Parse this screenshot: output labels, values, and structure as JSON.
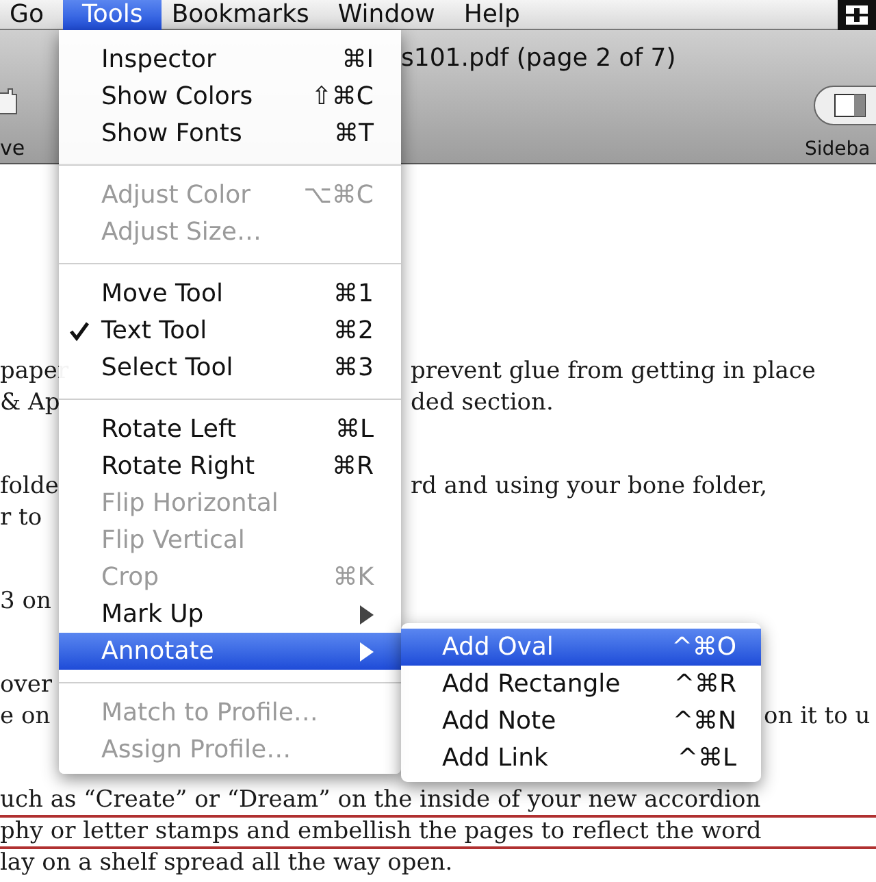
{
  "menu_bar": [
    {
      "label": "Go",
      "selected": false
    },
    {
      "label": "Tools",
      "selected": true
    },
    {
      "label": "Bookmarks",
      "selected": false
    },
    {
      "label": "Window",
      "selected": false
    },
    {
      "label": "Help",
      "selected": false
    }
  ],
  "window": {
    "title": "s101.pdf (page 2 of 7)"
  },
  "toolbar": {
    "left_label": "ve",
    "right_label": "Sideba"
  },
  "tools_menu": [
    {
      "kind": "item",
      "label": "Inspector",
      "shortcut": "⌘I",
      "disabled": false,
      "checked": false,
      "selected": false
    },
    {
      "kind": "item",
      "label": "Show Colors",
      "shortcut": "⇧⌘C",
      "disabled": false,
      "checked": false,
      "selected": false
    },
    {
      "kind": "item",
      "label": "Show Fonts",
      "shortcut": "⌘T",
      "disabled": false,
      "checked": false,
      "selected": false
    },
    {
      "kind": "separator"
    },
    {
      "kind": "item",
      "label": "Adjust Color",
      "shortcut": "⌥⌘C",
      "disabled": true,
      "checked": false,
      "selected": false
    },
    {
      "kind": "item",
      "label": "Adjust Size…",
      "disabled": true,
      "checked": false,
      "selected": false
    },
    {
      "kind": "separator"
    },
    {
      "kind": "item",
      "label": "Move Tool",
      "shortcut": "⌘1",
      "disabled": false,
      "checked": false,
      "selected": false
    },
    {
      "kind": "item",
      "label": "Text Tool",
      "shortcut": "⌘2",
      "disabled": false,
      "checked": true,
      "selected": false
    },
    {
      "kind": "item",
      "label": "Select Tool",
      "shortcut": "⌘3",
      "disabled": false,
      "checked": false,
      "selected": false
    },
    {
      "kind": "separator"
    },
    {
      "kind": "item",
      "label": "Rotate Left",
      "shortcut": "⌘L",
      "disabled": false,
      "checked": false,
      "selected": false
    },
    {
      "kind": "item",
      "label": "Rotate Right",
      "shortcut": "⌘R",
      "disabled": false,
      "checked": false,
      "selected": false
    },
    {
      "kind": "item",
      "label": "Flip Horizontal",
      "disabled": true,
      "checked": false,
      "selected": false
    },
    {
      "kind": "item",
      "label": "Flip Vertical",
      "disabled": true,
      "checked": false,
      "selected": false
    },
    {
      "kind": "item",
      "label": "Crop",
      "shortcut": "⌘K",
      "disabled": true,
      "checked": false,
      "selected": false
    },
    {
      "kind": "submenu",
      "label": "Mark Up",
      "disabled": false,
      "checked": false,
      "selected": false
    },
    {
      "kind": "submenu",
      "label": "Annotate",
      "disabled": false,
      "checked": false,
      "selected": true
    },
    {
      "kind": "separator"
    },
    {
      "kind": "item",
      "label": "Match to Profile…",
      "disabled": true,
      "checked": false,
      "selected": false
    },
    {
      "kind": "item",
      "label": "Assign Profile…",
      "disabled": true,
      "checked": false,
      "selected": false
    }
  ],
  "annotate_submenu": [
    {
      "label": "Add Oval",
      "shortcut": "^⌘O",
      "selected": true
    },
    {
      "label": "Add Rectangle",
      "shortcut": "^⌘R",
      "selected": false
    },
    {
      "label": "Add Note",
      "shortcut": "^⌘N",
      "selected": false
    },
    {
      "label": "Add Link",
      "shortcut": "^⌘L",
      "selected": false
    }
  ],
  "document": {
    "paragraphs": [
      [
        {
          "left": "paper",
          "right": "prevent glue from getting in place",
          "underlined": false
        },
        {
          "left": "& Ap",
          "right": "ded section.",
          "underlined": false
        }
      ],
      [
        {
          "left": "folde",
          "right": "rd and using your bone folder,",
          "underlined": false
        },
        {
          "left": "r to",
          "underlined": false
        }
      ],
      [
        {
          "left": "3 on",
          "underlined": false
        }
      ],
      [
        {
          "left": "over",
          "underlined": false
        },
        {
          "left": "e on",
          "far_right": "on it to u",
          "underlined": false
        }
      ],
      [
        {
          "left": "uch as “Create” or “Dream” on the inside of your new accordion",
          "underlined": true
        },
        {
          "left": "phy or letter stamps and embellish the pages to reflect the word",
          "underlined": true
        },
        {
          "left": "lay on a shelf spread all the way open.",
          "underlined": false
        }
      ]
    ]
  }
}
